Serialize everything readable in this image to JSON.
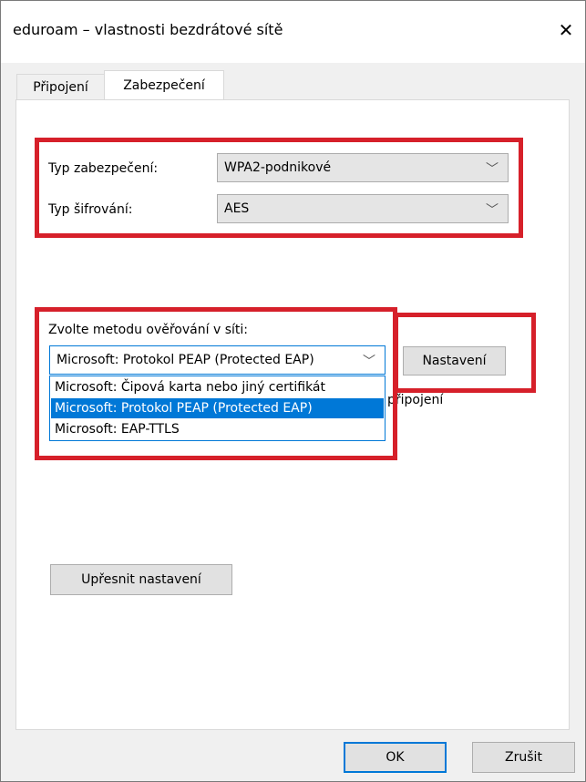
{
  "window": {
    "title": "eduroam – vlastnosti bezdrátové sítě"
  },
  "tabs": [
    {
      "label": "Připojení"
    },
    {
      "label": "Zabezpečení"
    }
  ],
  "security": {
    "type_label": "Typ zabezpečení:",
    "type_value": "WPA2-podnikové",
    "encryption_label": "Typ šifrování:",
    "encryption_value": "AES"
  },
  "auth": {
    "method_label": "Zvolte metodu ověřování v síti:",
    "selected_value": "Microsoft: Protokol PEAP (Protected EAP)",
    "options": [
      "Microsoft: Čipová karta nebo jiný certifikát",
      "Microsoft: Protokol PEAP (Protected EAP)",
      "Microsoft: EAP-TTLS"
    ],
    "settings_button": "Nastavení",
    "obscured_text": "připojení"
  },
  "advanced_button": "Upřesnit nastavení",
  "footer": {
    "ok": "OK",
    "cancel": "Zrušit"
  },
  "icons": {
    "close": "close-icon",
    "chevron": "chevron-down-icon"
  },
  "colors": {
    "highlight": "#d6202a",
    "selection": "#0078d7"
  }
}
